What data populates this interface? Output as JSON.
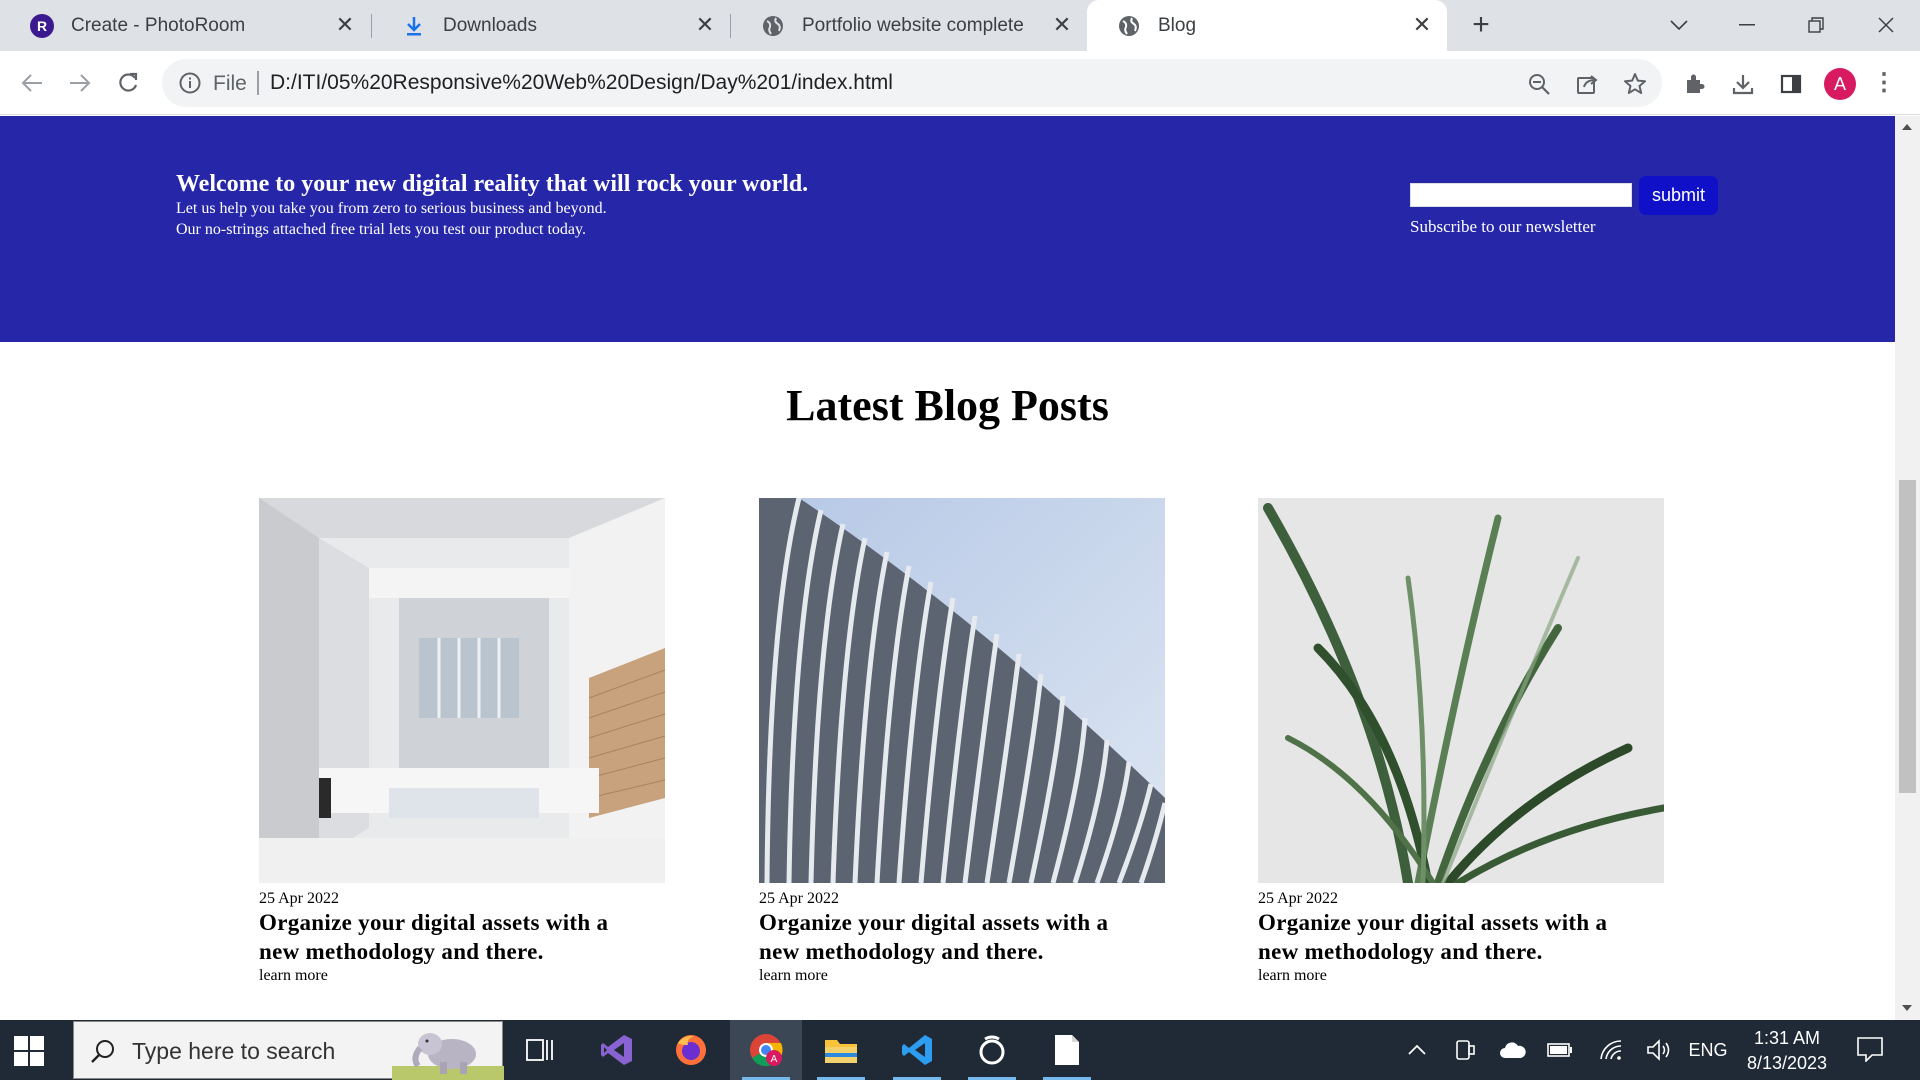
{
  "browser": {
    "tabs": [
      {
        "label": "Create - PhotoRoom",
        "icon": "photoroom-icon"
      },
      {
        "label": "Downloads",
        "icon": "download-icon"
      },
      {
        "label": "Portfolio website complete",
        "icon": "globe-icon"
      },
      {
        "label": "Blog",
        "icon": "globe-icon",
        "active": true
      }
    ],
    "close_glyph": "✕",
    "address": {
      "scheme": "File",
      "url": "D:/ITI/05%20Responsive%20Web%20Design/Day%201/index.html"
    },
    "profile_initial": "A"
  },
  "page": {
    "hero": {
      "title": "Welcome to your new digital reality that will rock your world.",
      "line1": "Let us help you take you from zero to serious business and beyond.",
      "line2": "Our no-strings attached free trial lets you test our product today.",
      "newsletter_submit": "submit",
      "newsletter_label": "Subscribe to our newsletter",
      "background_color": "#2626a8"
    },
    "section_title": "Latest Blog Posts",
    "posts": [
      {
        "date": "25 Apr 2022",
        "title_line1": "Organize your digital assets with a",
        "title_line2": "new methodology and there.",
        "link": "learn more",
        "image": "white-interior-photo"
      },
      {
        "date": "25 Apr 2022",
        "title_line1": "Organize your digital assets with a",
        "title_line2": "new methodology and there.",
        "link": "learn more",
        "image": "curved-facade-photo"
      },
      {
        "date": "25 Apr 2022",
        "title_line1": "Organize your digital assets with a",
        "title_line2": "new methodology and there.",
        "link": "learn more",
        "image": "grass-plant-photo"
      }
    ]
  },
  "taskbar": {
    "search_placeholder": "Type here to search",
    "language": "ENG",
    "time": "1:31 AM",
    "date": "8/13/2023"
  }
}
